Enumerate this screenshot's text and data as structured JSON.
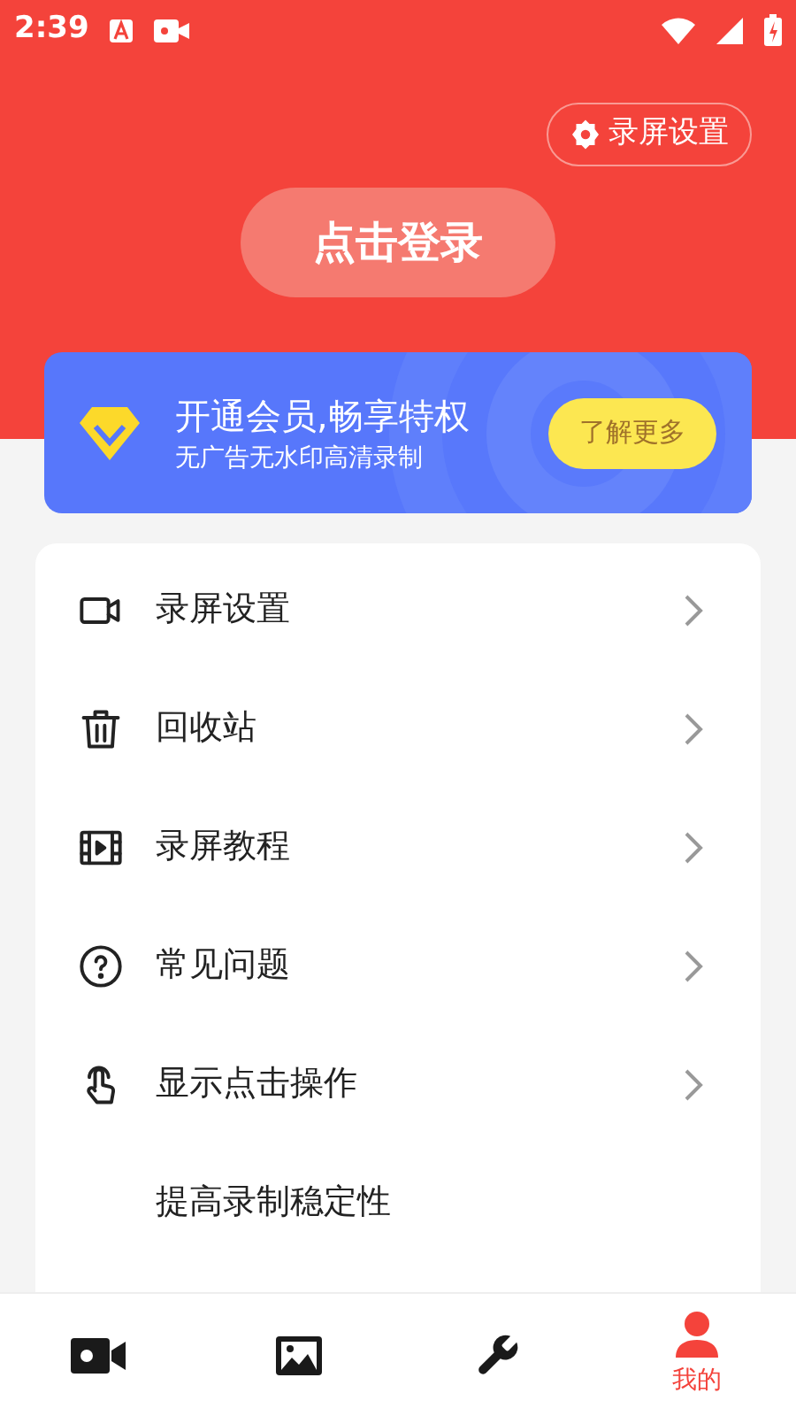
{
  "status_bar": {
    "time": "2:39"
  },
  "header": {
    "settings_button": "录屏设置",
    "login_button": "点击登录"
  },
  "vip_card": {
    "title": "开通会员,畅享特权",
    "subtitle": "无广告无水印高清录制",
    "button": "了解更多"
  },
  "menu": [
    {
      "kind": "video",
      "label": "录屏设置"
    },
    {
      "kind": "trash",
      "label": "回收站"
    },
    {
      "kind": "film",
      "label": "录屏教程"
    },
    {
      "kind": "help",
      "label": "常见问题"
    },
    {
      "kind": "touch",
      "label": "显示点击操作"
    },
    {
      "kind": "none",
      "label": "提高录制稳定性"
    }
  ],
  "bottom_nav": [
    {
      "kind": "record",
      "selected": false
    },
    {
      "kind": "gallery",
      "selected": false
    },
    {
      "kind": "tools",
      "selected": false
    },
    {
      "kind": "profile",
      "selected": true,
      "label": "我的"
    }
  ]
}
